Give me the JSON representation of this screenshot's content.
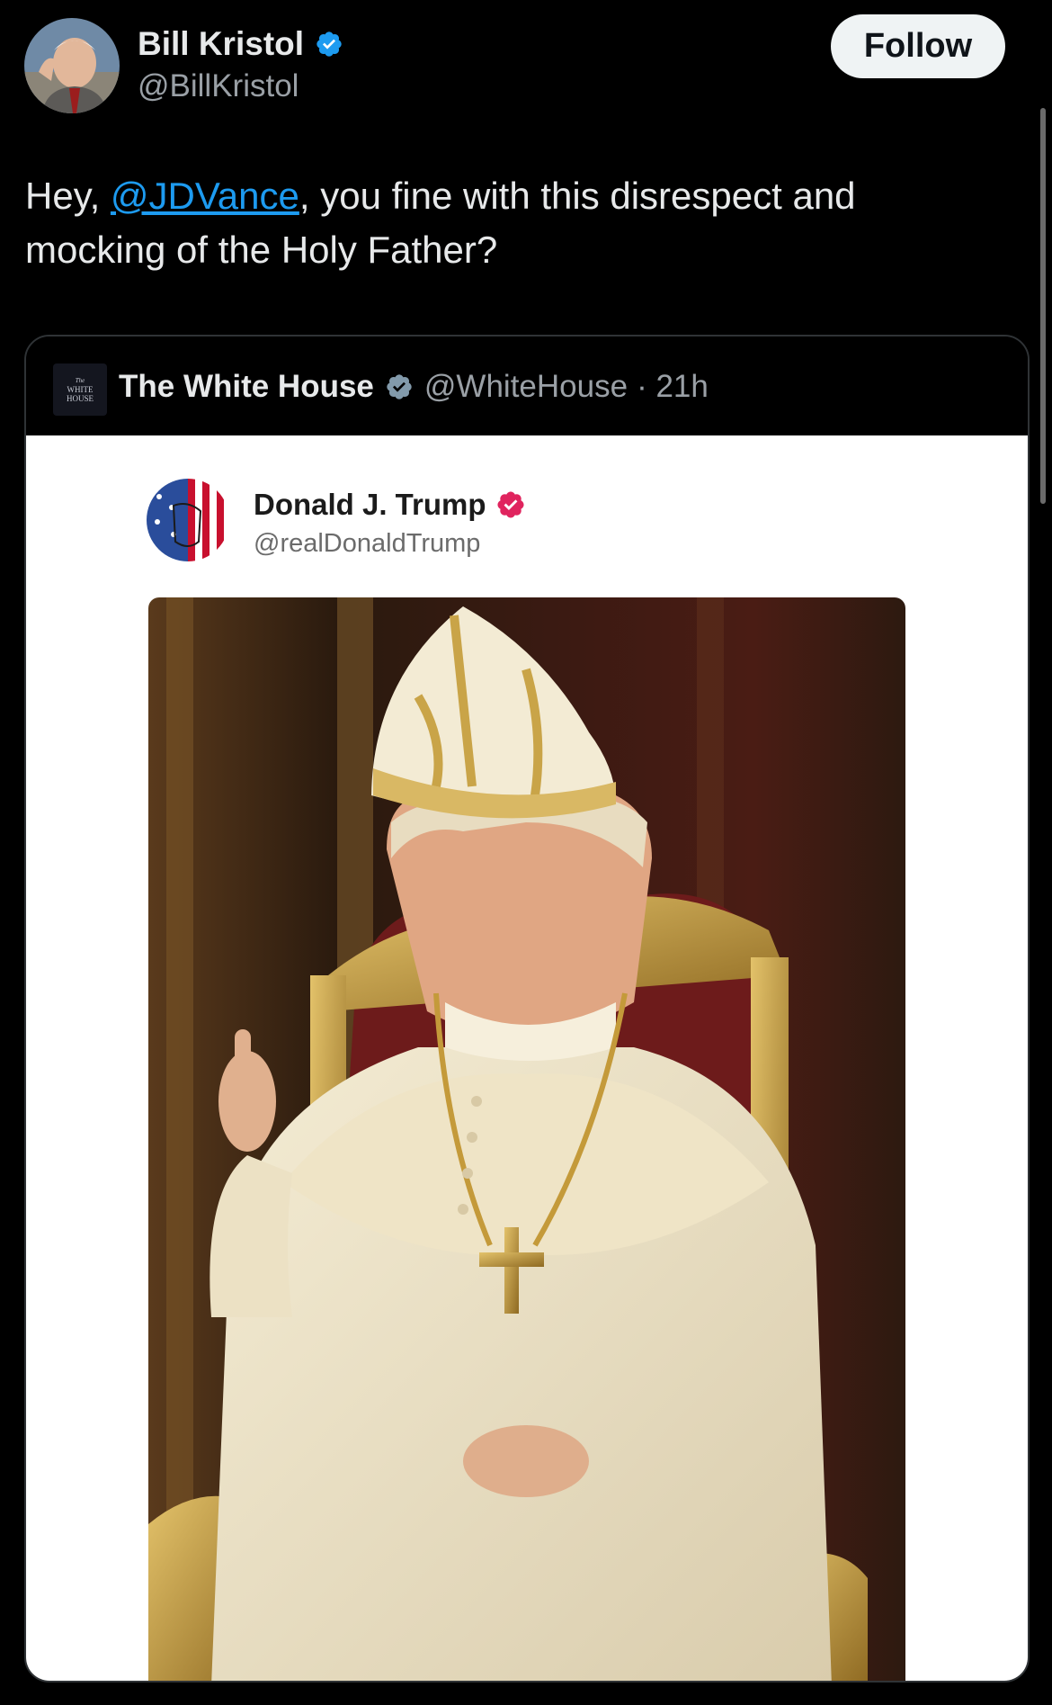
{
  "author": {
    "name": "Bill Kristol",
    "handle": "@BillKristol",
    "avatar_icon": "avatar-photo-icon",
    "verified_color": "#1d9bf0"
  },
  "follow_label": "Follow",
  "tweet": {
    "prefix": "Hey, ",
    "mention": "@JDVance",
    "suffix": ", you fine with this disrespect and mocking of the Holy Father?"
  },
  "quoted": {
    "logo_lines": [
      "The",
      "WHITE",
      "HOUSE"
    ],
    "name": "The White House",
    "handle": "@WhiteHouse",
    "time": "· 21h",
    "verified_color": "#829aab"
  },
  "embedded_post": {
    "name": "Donald J. Trump",
    "handle": "@realDonaldTrump",
    "verified_color": "#e0245e",
    "image_icon": "ai-generated-pope-portrait-image"
  },
  "colors": {
    "background": "#000000",
    "accent": "#1d9bf0",
    "follow_bg": "#eff3f4"
  }
}
